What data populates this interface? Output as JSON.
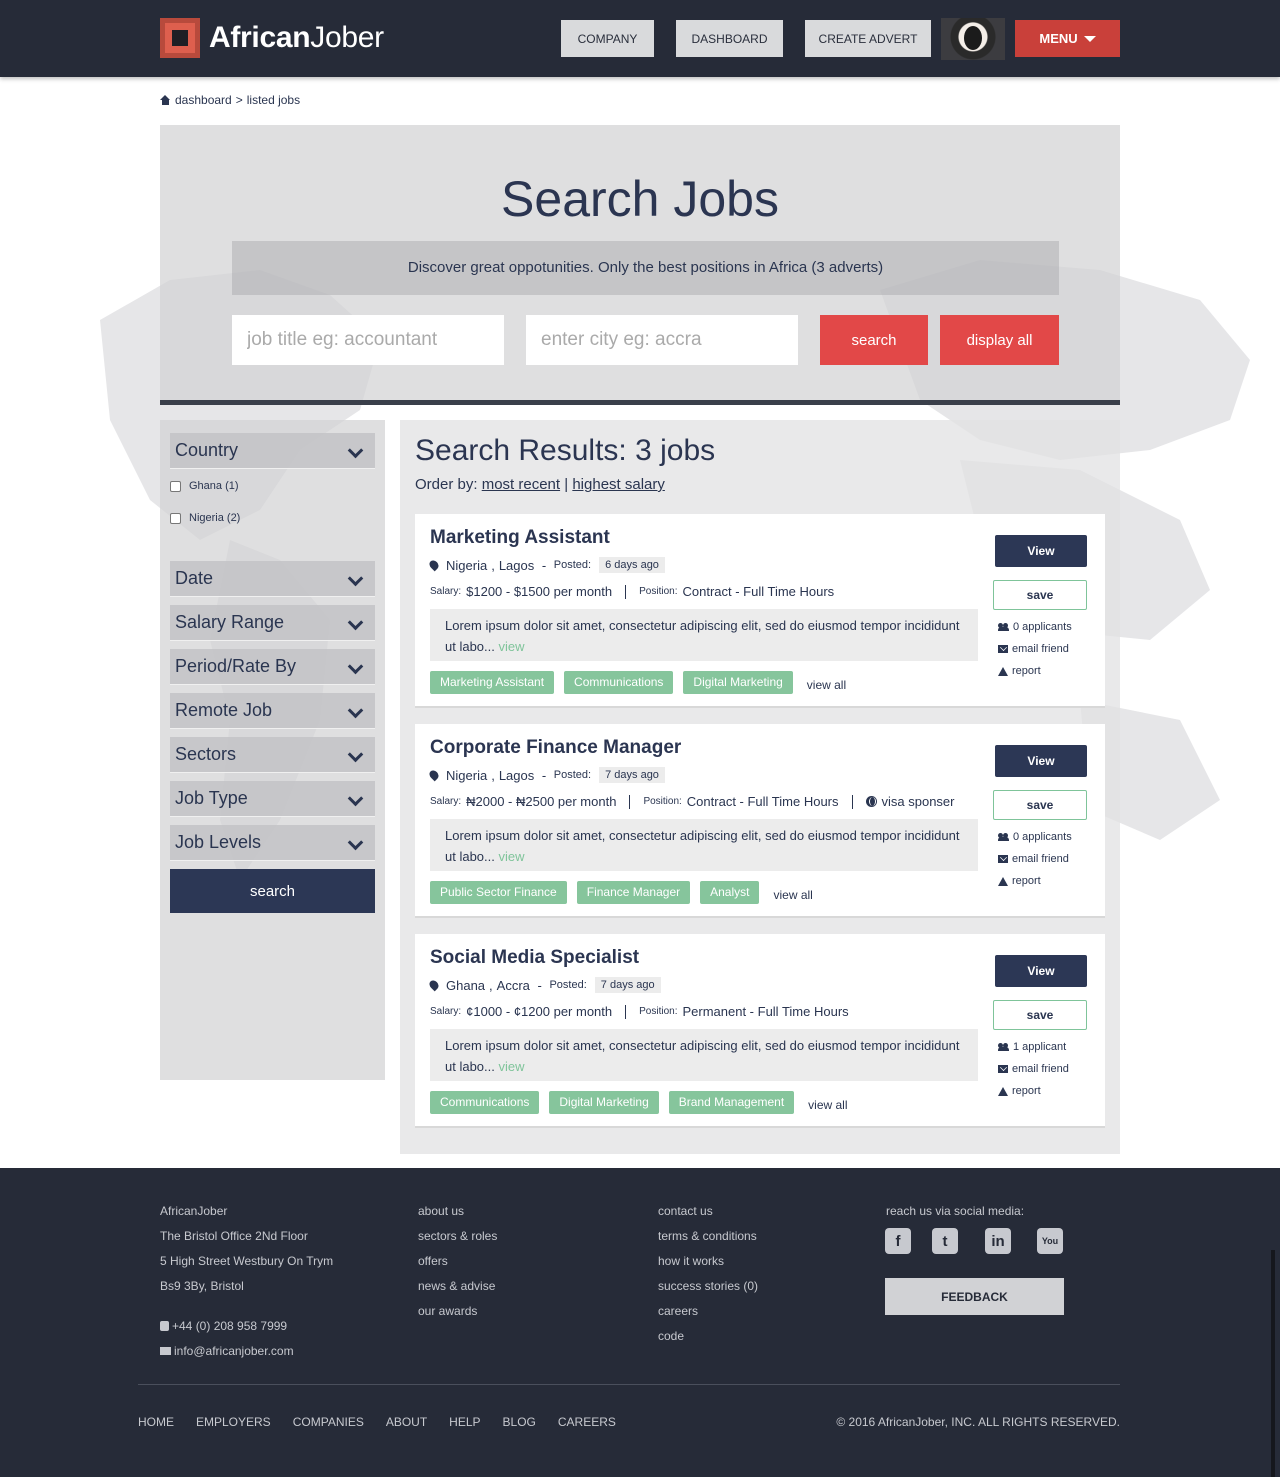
{
  "header": {
    "logo_bold": "African",
    "logo_light": "Jober",
    "nav": [
      "COMPANY",
      "DASHBOARD",
      "CREATE ADVERT"
    ],
    "menu_label": "MENU"
  },
  "breadcrumb": {
    "home": "dashboard",
    "separator": ">",
    "current": "listed jobs"
  },
  "hero": {
    "title": "Search Jobs",
    "subtitle": "Discover great oppotunities. Only the best positions in Africa (3 adverts)",
    "job_placeholder": "job title eg: accountant",
    "city_placeholder": "enter city eg: accra",
    "search_label": "search",
    "display_all_label": "display all"
  },
  "sidebar": {
    "country_label": "Country",
    "countries": [
      "Ghana (1)",
      "Nigeria (2)"
    ],
    "filters": [
      "Date",
      "Salary Range",
      "Period/Rate By",
      "Remote Job",
      "Sectors",
      "Job Type",
      "Job Levels"
    ],
    "search_label": "search"
  },
  "results": {
    "title": "Search Results: 3 jobs",
    "order_by_label": "Order by:",
    "order_recent": "most recent",
    "order_sep": "|",
    "order_salary": "highest salary",
    "posted_label": "Posted:",
    "salary_label": "Salary:",
    "position_label": "Position:",
    "view_label": "View",
    "save_label": "save",
    "email_label": "email friend",
    "report_label": "report",
    "view_all_label": "view all",
    "desc_view_label": "view",
    "jobs": [
      {
        "title": "Marketing Assistant",
        "country": "Nigeria",
        "city": "Lagos",
        "posted": "6 days ago",
        "salary": "$1200 - $1500 per month",
        "position": "Contract - Full Time Hours",
        "visa": "",
        "description": "Lorem ipsum dolor sit amet, consectetur adipiscing elit, sed do eiusmod tempor incididunt ut labo...",
        "tags": [
          "Marketing Assistant",
          "Communications",
          "Digital Marketing"
        ],
        "applicants": "0 applicants"
      },
      {
        "title": "Corporate Finance Manager",
        "country": "Nigeria",
        "city": "Lagos",
        "posted": "7 days ago",
        "salary": "₦2000 - ₦2500 per month",
        "position": "Contract - Full Time Hours",
        "visa": "visa sponser",
        "description": "Lorem ipsum dolor sit amet, consectetur adipiscing elit, sed do eiusmod tempor incididunt ut labo...",
        "tags": [
          "Public Sector Finance",
          "Finance Manager",
          "Analyst"
        ],
        "applicants": "0 applicants"
      },
      {
        "title": "Social Media Specialist",
        "country": "Ghana",
        "city": "Accra",
        "posted": "7 days ago",
        "salary": "¢1000 - ¢1200 per month",
        "position": "Permanent - Full Time Hours",
        "visa": "",
        "description": "Lorem ipsum dolor sit amet, consectetur adipiscing elit, sed do eiusmod tempor incididunt ut labo...",
        "tags": [
          "Communications",
          "Digital Marketing",
          "Brand Management"
        ],
        "applicants": "1 applicant"
      }
    ]
  },
  "footer": {
    "address": [
      "AfricanJober",
      "The Bristol Office 2Nd Floor",
      "5 High Street Westbury On Trym",
      "Bs9 3By, Bristol"
    ],
    "phone": "+44 (0) 208 958 7999",
    "email": "info@africanjober.com",
    "col2": [
      "about us",
      "sectors & roles",
      "offers",
      "news & advise",
      "our awards"
    ],
    "col3": [
      "contact us",
      "terms & conditions",
      "how it works",
      "success stories (0)",
      "careers",
      "code"
    ],
    "social_title": "reach us via social media:",
    "social_icons": [
      "facebook-icon",
      "twitter-icon",
      "linkedin-icon",
      "youtube-icon"
    ],
    "feedback_label": "FEEDBACK",
    "nav": [
      "HOME",
      "EMPLOYERS",
      "COMPANIES",
      "ABOUT",
      "HELP",
      "BLOG",
      "CAREERS"
    ],
    "copyright": "© 2016 AfricanJober, INC. ALL RIGHTS RESERVED."
  },
  "colors": {
    "header_bg": "#262b38",
    "accent_red": "#e24848",
    "navy": "#2c3755",
    "tag_green": "#86c59c"
  }
}
